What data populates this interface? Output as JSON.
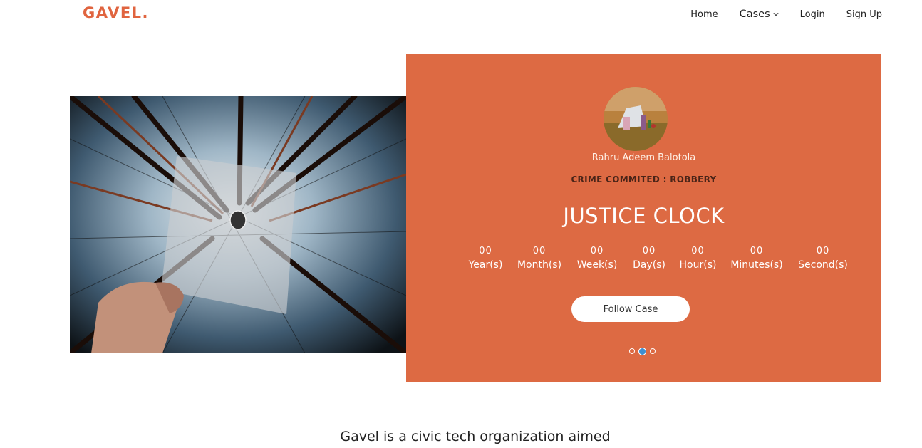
{
  "brand": {
    "logo_text": "GAVEL.",
    "accent": "#e0643f"
  },
  "nav": {
    "home": "Home",
    "cases": "Cases",
    "login": "Login",
    "signup": "Sign Up"
  },
  "hero": {
    "image_icon": "forest-photo",
    "panel_color": "#dd6a43",
    "profile": {
      "avatar_icon": "avatar-photo",
      "name": "Rahru Adeem Balotola",
      "crime": "CRIME COMMITED : ROBBERY"
    },
    "clock": {
      "title": "JUSTICE CLOCK",
      "units": [
        {
          "value": "00",
          "label": "Year(s)"
        },
        {
          "value": "00",
          "label": "Month(s)"
        },
        {
          "value": "00",
          "label": "Week(s)"
        },
        {
          "value": "00",
          "label": "Day(s)"
        },
        {
          "value": "00",
          "label": "Hour(s)"
        },
        {
          "value": "00",
          "label": "Minutes(s)"
        },
        {
          "value": "00",
          "label": "Second(s)"
        }
      ]
    },
    "follow_button": "Follow Case",
    "carousel": {
      "active_index": 1,
      "count": 3,
      "active_color": "#3f8fd0"
    }
  },
  "tagline": "Gavel is a civic tech organization aimed"
}
